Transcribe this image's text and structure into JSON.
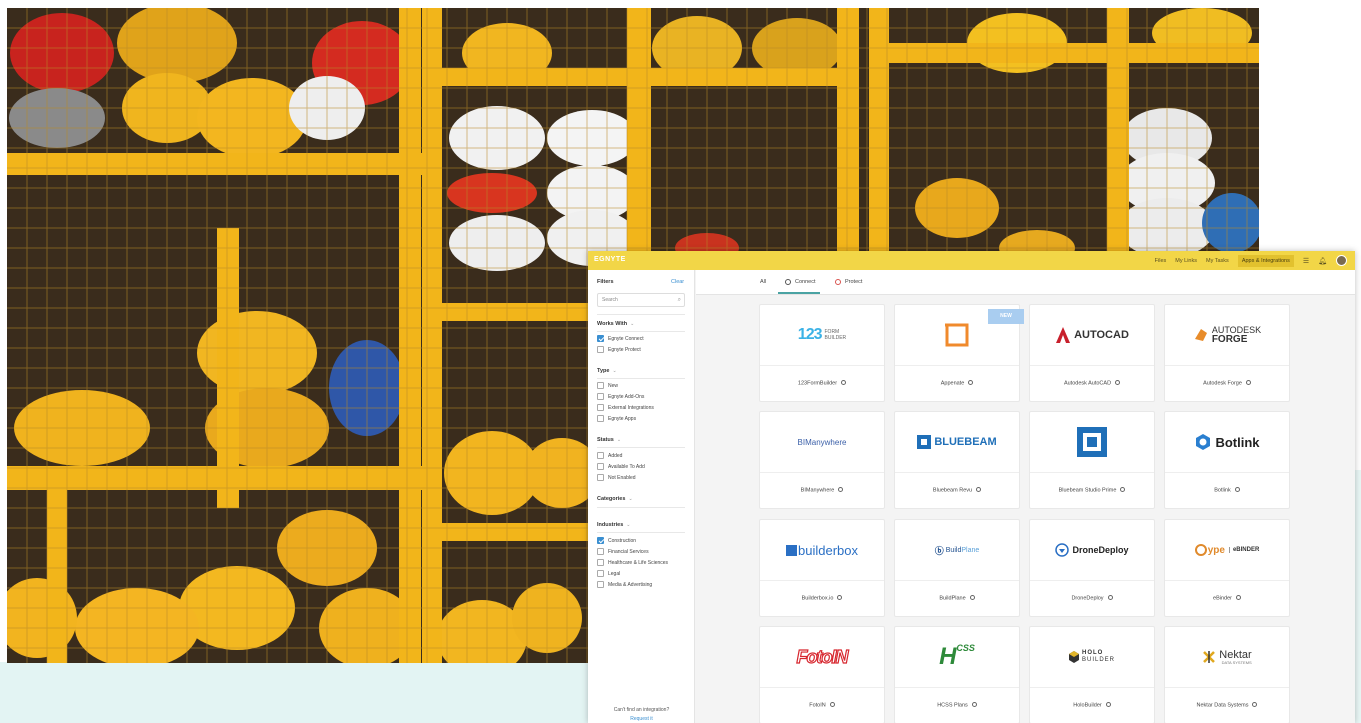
{
  "app": {
    "logo": "EGNYTE",
    "nav": [
      "Files",
      "My Links",
      "My Tasks",
      "Apps & Integrations"
    ],
    "nav_active_index": 3
  },
  "filters": {
    "title": "Filters",
    "clear": "Clear",
    "search_placeholder": "Search",
    "sections": [
      {
        "title": "Works With",
        "options": [
          {
            "label": "Egnyte Connect",
            "checked": true
          },
          {
            "label": "Egnyte Protect",
            "checked": false
          }
        ]
      },
      {
        "title": "Type",
        "options": [
          {
            "label": "New",
            "checked": false
          },
          {
            "label": "Egnyte Add-Ons",
            "checked": false
          },
          {
            "label": "External Integrations",
            "checked": false
          },
          {
            "label": "Egnyte Apps",
            "checked": false
          }
        ]
      },
      {
        "title": "Status",
        "options": [
          {
            "label": "Added",
            "checked": false
          },
          {
            "label": "Available To Add",
            "checked": false
          },
          {
            "label": "Not Enabled",
            "checked": false
          }
        ]
      },
      {
        "title": "Categories",
        "options": []
      },
      {
        "title": "Industries",
        "options": [
          {
            "label": "Construction",
            "checked": true
          },
          {
            "label": "Financial Services",
            "checked": false
          },
          {
            "label": "Healthcare & Life Sciences",
            "checked": false
          },
          {
            "label": "Legal",
            "checked": false
          },
          {
            "label": "Media & Advertising",
            "checked": false
          }
        ]
      }
    ],
    "footer_text": "Can't find an integration?",
    "footer_link": "Request it"
  },
  "tabs": [
    "All",
    "Connect",
    "Protect"
  ],
  "tab_active_index": 1,
  "badge_new": "NEW",
  "logo_text": {
    "form_builder_num": "123",
    "form_builder_a": "FORM",
    "form_builder_b": "BUILDER",
    "autocad": "AUTOCAD",
    "forge_a": "AUTODESK",
    "forge_b": "FORGE",
    "bimanywhere": "BIManywhere",
    "bluebeam": "BLUEBEAM",
    "botlink": "Botlink",
    "builderbox": "builderbox",
    "buildplane_a": "Build",
    "buildplane_b": "Plane",
    "dronedeploy": "DroneDeploy",
    "ebinder_a": "ype",
    "ebinder_b": "eBINDER",
    "fotoin": "FotoIN",
    "hcss_a": "H",
    "hcss_b": "CSS",
    "holo_a": "HOLO",
    "holo_b": "BUILDER",
    "nektar_a": "Nektar",
    "nektar_b": "DATA SYSTEMS"
  },
  "integrations": [
    "123FormBuilder",
    "Appenate",
    "Autodesk AutoCAD",
    "Autodesk Forge",
    "BIManywhere",
    "Bluebeam Revu",
    "Bluebeam Studio Prime",
    "Botlink",
    "Builderbox.io",
    "BuildPlane",
    "DroneDeploy",
    "eBinder",
    "FotoIN",
    "HCSS Plans",
    "HoloBuilder",
    "Nektar Data Systems"
  ],
  "colors": {
    "topbar": "#f2d647",
    "accent": "#3a8fd1",
    "teal": "#4aa3a3"
  }
}
